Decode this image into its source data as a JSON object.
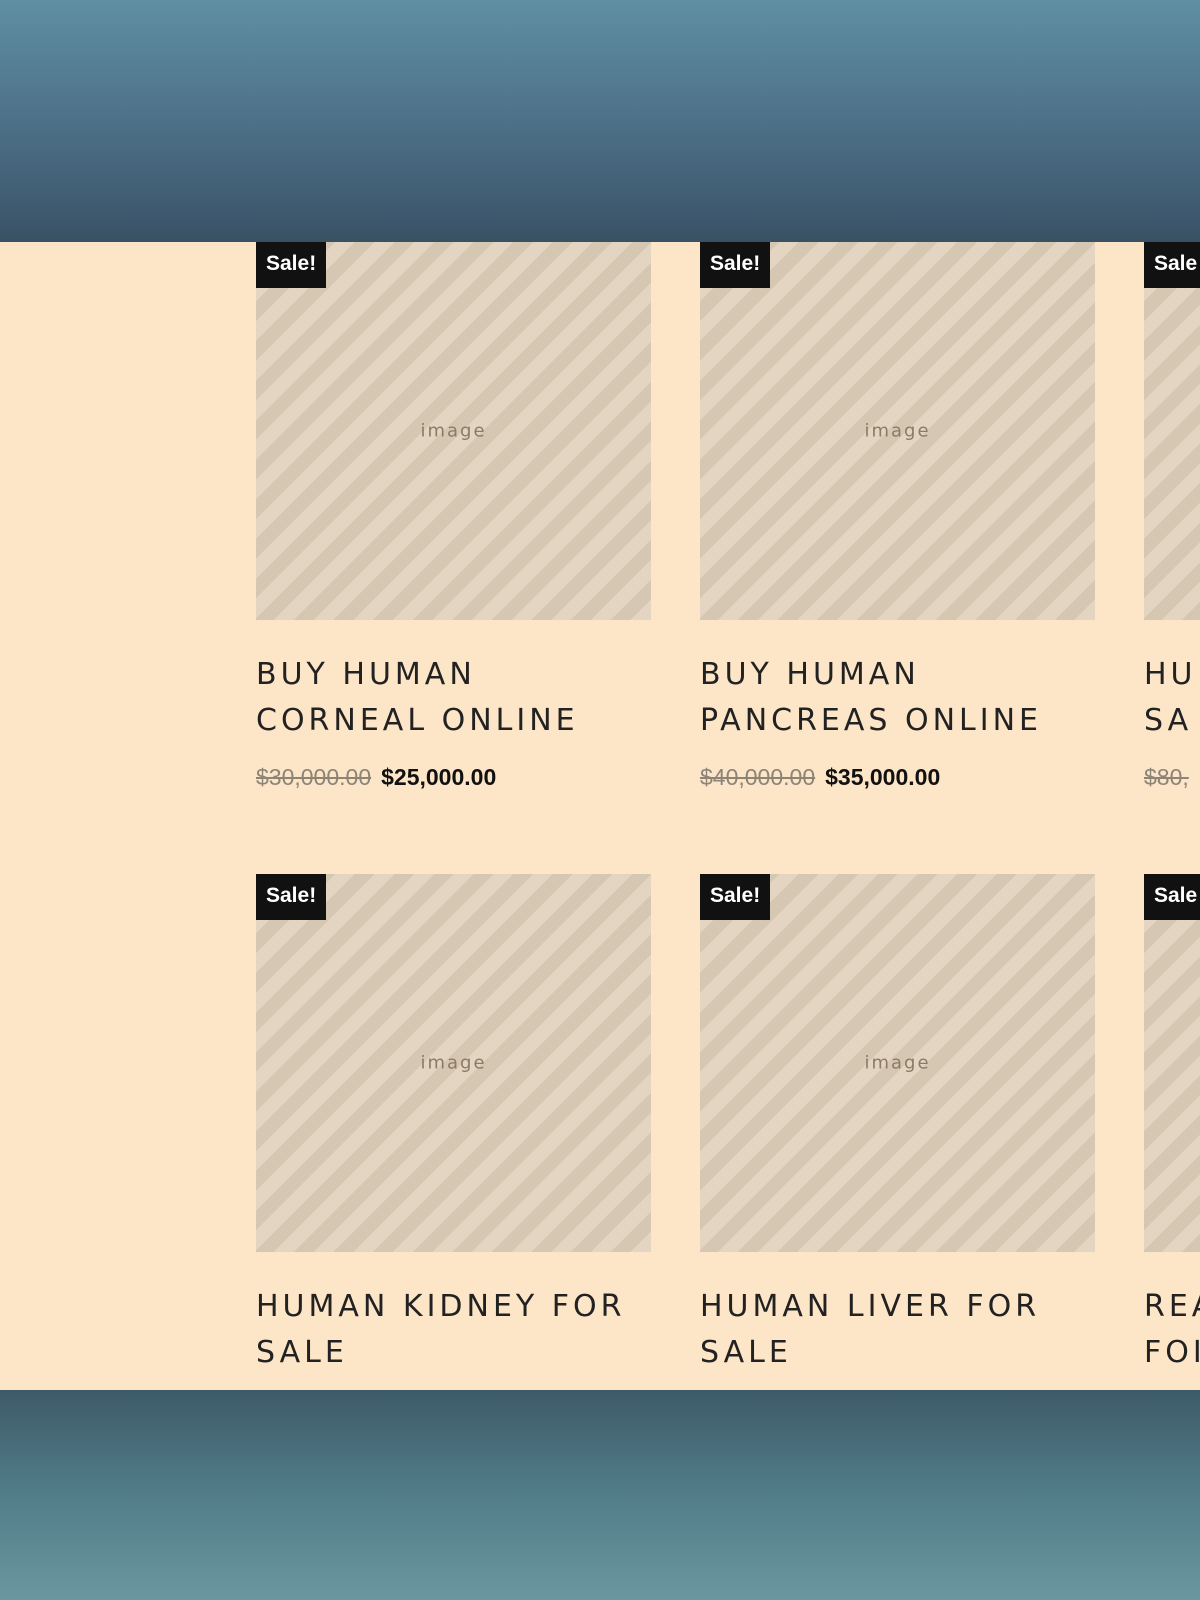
{
  "products": [
    {
      "badge": "Sale!",
      "title_line1": "BUY HUMAN",
      "title_line2": "CORNEAL ONLINE",
      "old_price": "$30,000.00",
      "new_price": "$25,000.00",
      "image_alt": "eye-photo"
    },
    {
      "badge": "Sale!",
      "title_line1": "BUY HUMAN",
      "title_line2": "PANCREAS ONLINE",
      "old_price": "$40,000.00",
      "new_price": "$35,000.00",
      "image_alt": "surgical-photo"
    },
    {
      "badge": "Sale",
      "title_line1": "HU",
      "title_line2": "SA",
      "old_price": "$80,",
      "new_price": "",
      "image_alt": "surgical-photo"
    },
    {
      "badge": "Sale!",
      "title_line1": "HUMAN KIDNEY FOR",
      "title_line2": "SALE",
      "image_alt": "surgical-photo"
    },
    {
      "badge": "Sale!",
      "title_line1": "HUMAN LIVER FOR",
      "title_line2": "SALE",
      "image_alt": "surgical-photo"
    },
    {
      "badge": "Sale",
      "title_line1": "REA",
      "title_line2": "FOI",
      "image_alt": "surgical-photo"
    }
  ],
  "placeholder_label": "image",
  "colors": {
    "panel_bg": "#fde5c7",
    "badge_bg": "#111111",
    "badge_text": "#ffffff"
  }
}
